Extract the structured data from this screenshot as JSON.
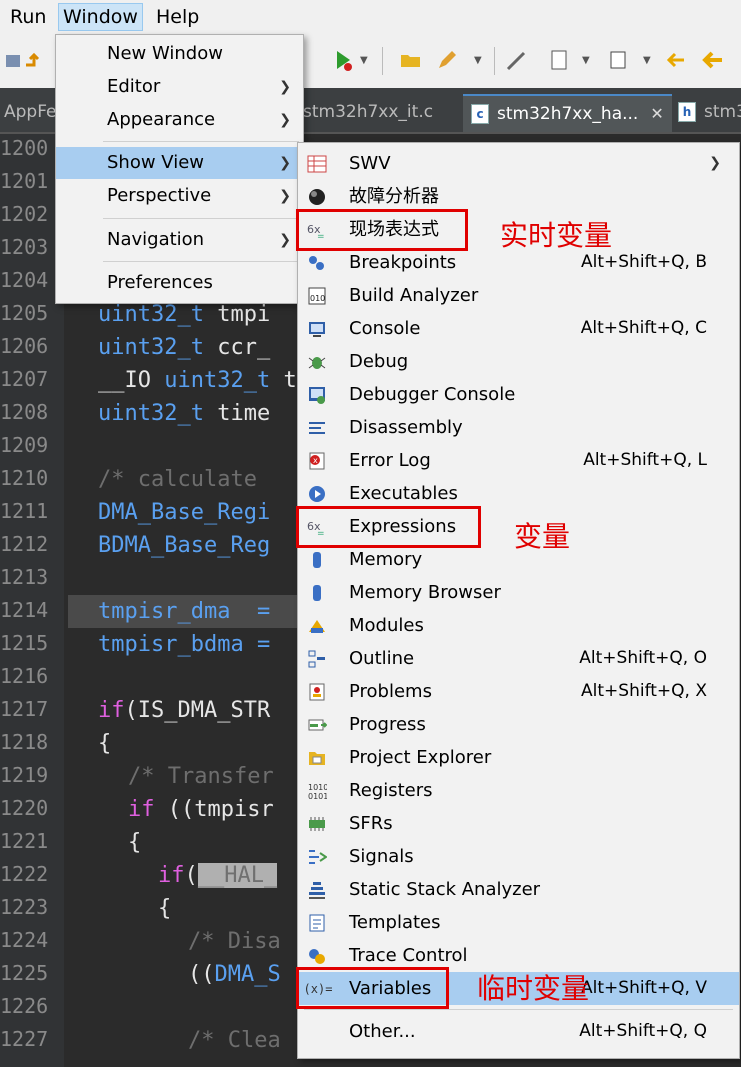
{
  "menubar": {
    "items": [
      "Run",
      "Window",
      "Help"
    ],
    "active": "Window"
  },
  "tabs": [
    {
      "label": "AppFe"
    },
    {
      "label": "stm32h7xx_it.c"
    },
    {
      "label": "stm32h7xx_ha...",
      "icon": "c",
      "close": "✕"
    },
    {
      "label": "stm3",
      "icon": "h"
    }
  ],
  "editor": {
    "line_numbers": [
      "1200",
      "1201",
      "1202",
      "1203",
      "1204",
      "1205",
      "1206",
      "1207",
      "1208",
      "1209",
      "1210",
      "1211",
      "1212",
      "1213",
      "1214",
      "1215",
      "1216",
      "1217",
      "1218",
      "1219",
      "1220",
      "1221",
      "1222",
      "1223",
      "1224",
      "1225",
      "1226",
      "1227"
    ],
    "lines": {
      "l1205a": "uint32_t",
      "l1205b": " tmpi",
      "l1206a": "uint32_t",
      "l1206b": " ccr_",
      "l1207a": "__IO ",
      "l1207b": "uint32_t",
      "l1207c": " t",
      "l1208a": "uint32_t",
      "l1208b": " time",
      "l1210": "/* calculate",
      "l1211": "DMA_Base_Regi",
      "l1212": "BDMA_Base_Reg",
      "l1214": "tmpisr_dma  =",
      "l1215": "tmpisr_bdma =",
      "l1217a": "if",
      "l1217b": "(IS_DMA_STR",
      "l1218": "{",
      "l1219": "/* Transfer",
      "l1220a": "if",
      "l1220b": " ((tmpisr",
      "l1221": "{",
      "l1222a": "if",
      "l1222b": "(",
      "l1222c": "__HAL_",
      "l1223": "{",
      "l1224": "/* Disa",
      "l1225a": "((",
      "l1225b": "DMA_S",
      "l1227": "/* Clea"
    }
  },
  "window_menu": {
    "items": [
      {
        "label": "New Window",
        "submenu": false
      },
      {
        "label": "Editor",
        "submenu": true
      },
      {
        "label": "Appearance",
        "submenu": true
      },
      {
        "label": "Show View",
        "submenu": true,
        "highlighted": true
      },
      {
        "label": "Perspective",
        "submenu": true
      },
      {
        "label": "Navigation",
        "submenu": true
      },
      {
        "label": "Preferences",
        "submenu": false
      }
    ]
  },
  "show_view_menu": {
    "items": [
      {
        "label": "SWV",
        "shortcut": "",
        "submenu": true,
        "icon": "swv-icon"
      },
      {
        "label": "故障分析器",
        "shortcut": "",
        "icon": "fault-analyzer-icon"
      },
      {
        "label": "现场表达式",
        "shortcut": "",
        "icon": "live-expressions-icon"
      },
      {
        "label": "Breakpoints",
        "shortcut": "Alt+Shift+Q, B",
        "icon": "breakpoints-icon"
      },
      {
        "label": "Build Analyzer",
        "shortcut": "",
        "icon": "build-analyzer-icon"
      },
      {
        "label": "Console",
        "shortcut": "Alt+Shift+Q, C",
        "icon": "console-icon"
      },
      {
        "label": "Debug",
        "shortcut": "",
        "icon": "debug-icon"
      },
      {
        "label": "Debugger Console",
        "shortcut": "",
        "icon": "debugger-console-icon"
      },
      {
        "label": "Disassembly",
        "shortcut": "",
        "icon": "disassembly-icon"
      },
      {
        "label": "Error Log",
        "shortcut": "Alt+Shift+Q, L",
        "icon": "error-log-icon"
      },
      {
        "label": "Executables",
        "shortcut": "",
        "icon": "executables-icon"
      },
      {
        "label": "Expressions",
        "shortcut": "",
        "icon": "expressions-icon"
      },
      {
        "label": "Memory",
        "shortcut": "",
        "icon": "memory-icon"
      },
      {
        "label": "Memory Browser",
        "shortcut": "",
        "icon": "memory-browser-icon"
      },
      {
        "label": "Modules",
        "shortcut": "",
        "icon": "modules-icon"
      },
      {
        "label": "Outline",
        "shortcut": "Alt+Shift+Q, O",
        "icon": "outline-icon"
      },
      {
        "label": "Problems",
        "shortcut": "Alt+Shift+Q, X",
        "icon": "problems-icon"
      },
      {
        "label": "Progress",
        "shortcut": "",
        "icon": "progress-icon"
      },
      {
        "label": "Project Explorer",
        "shortcut": "",
        "icon": "project-explorer-icon"
      },
      {
        "label": "Registers",
        "shortcut": "",
        "icon": "registers-icon"
      },
      {
        "label": "SFRs",
        "shortcut": "",
        "icon": "sfrs-icon"
      },
      {
        "label": "Signals",
        "shortcut": "",
        "icon": "signals-icon"
      },
      {
        "label": "Static Stack Analyzer",
        "shortcut": "",
        "icon": "static-stack-analyzer-icon"
      },
      {
        "label": "Templates",
        "shortcut": "",
        "icon": "templates-icon"
      },
      {
        "label": "Trace Control",
        "shortcut": "",
        "icon": "trace-control-icon"
      },
      {
        "label": "Variables",
        "shortcut": "Alt+Shift+Q, V",
        "icon": "variables-icon",
        "highlighted": true
      },
      {
        "label": "Other...",
        "shortcut": "Alt+Shift+Q, Q",
        "icon": ""
      }
    ]
  },
  "annotations": {
    "live_vars": "实时变量",
    "vars": "变量",
    "temp_vars": "临时变量",
    "color": "#e00000"
  }
}
